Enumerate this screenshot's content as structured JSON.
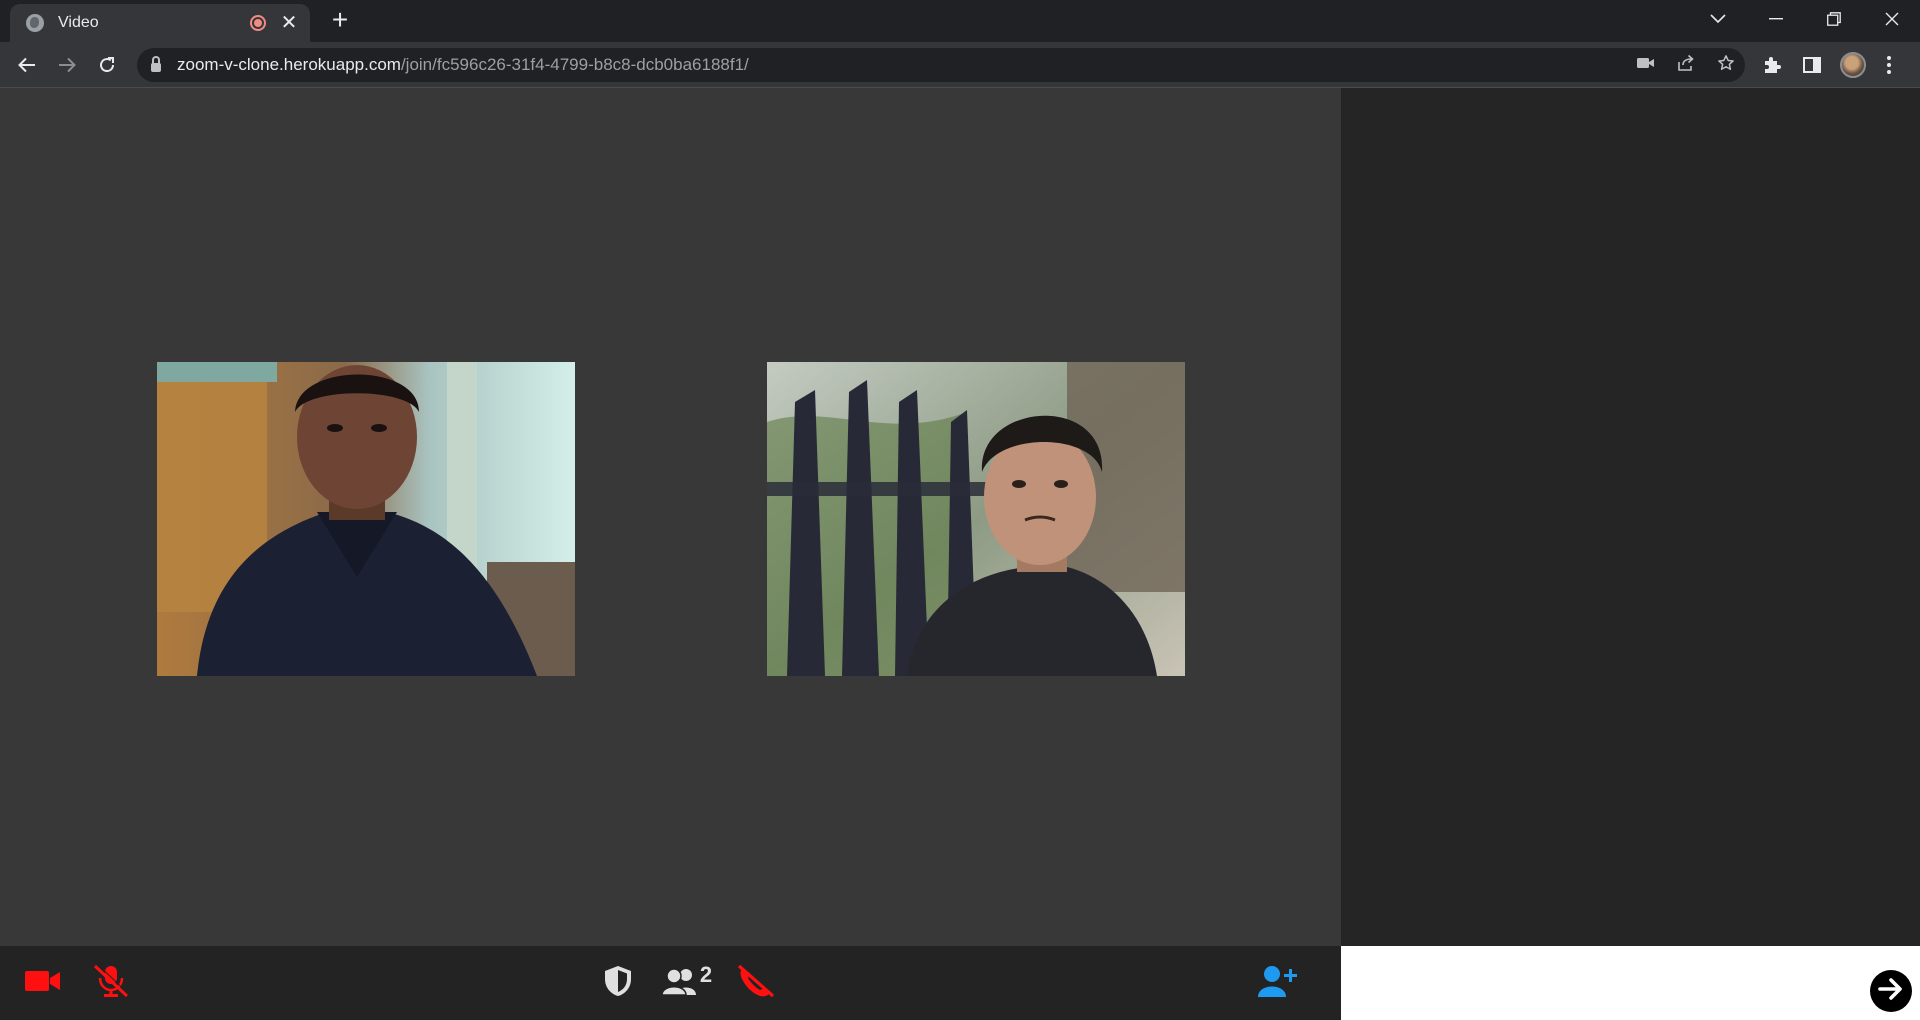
{
  "browser": {
    "tab_title": "Video",
    "tab_close_glyph": "✕",
    "new_tab_glyph": "+",
    "url_host": "zoom-v-clone.herokuapp.com",
    "url_path": "/join/fc596c26-31f4-4799-b8c8-dcb0ba6188f1/"
  },
  "videos": [
    {
      "name": "local-participant",
      "icon": "webcam-feed"
    },
    {
      "name": "remote-participant",
      "icon": "webcam-feed"
    }
  ],
  "controls": {
    "participant_count": "2",
    "colors": {
      "danger": "#ff1010",
      "accent": "#1e9bf0",
      "neutral": "#e0e0e0"
    }
  },
  "chat": {
    "input_value": "",
    "placeholder": ""
  }
}
